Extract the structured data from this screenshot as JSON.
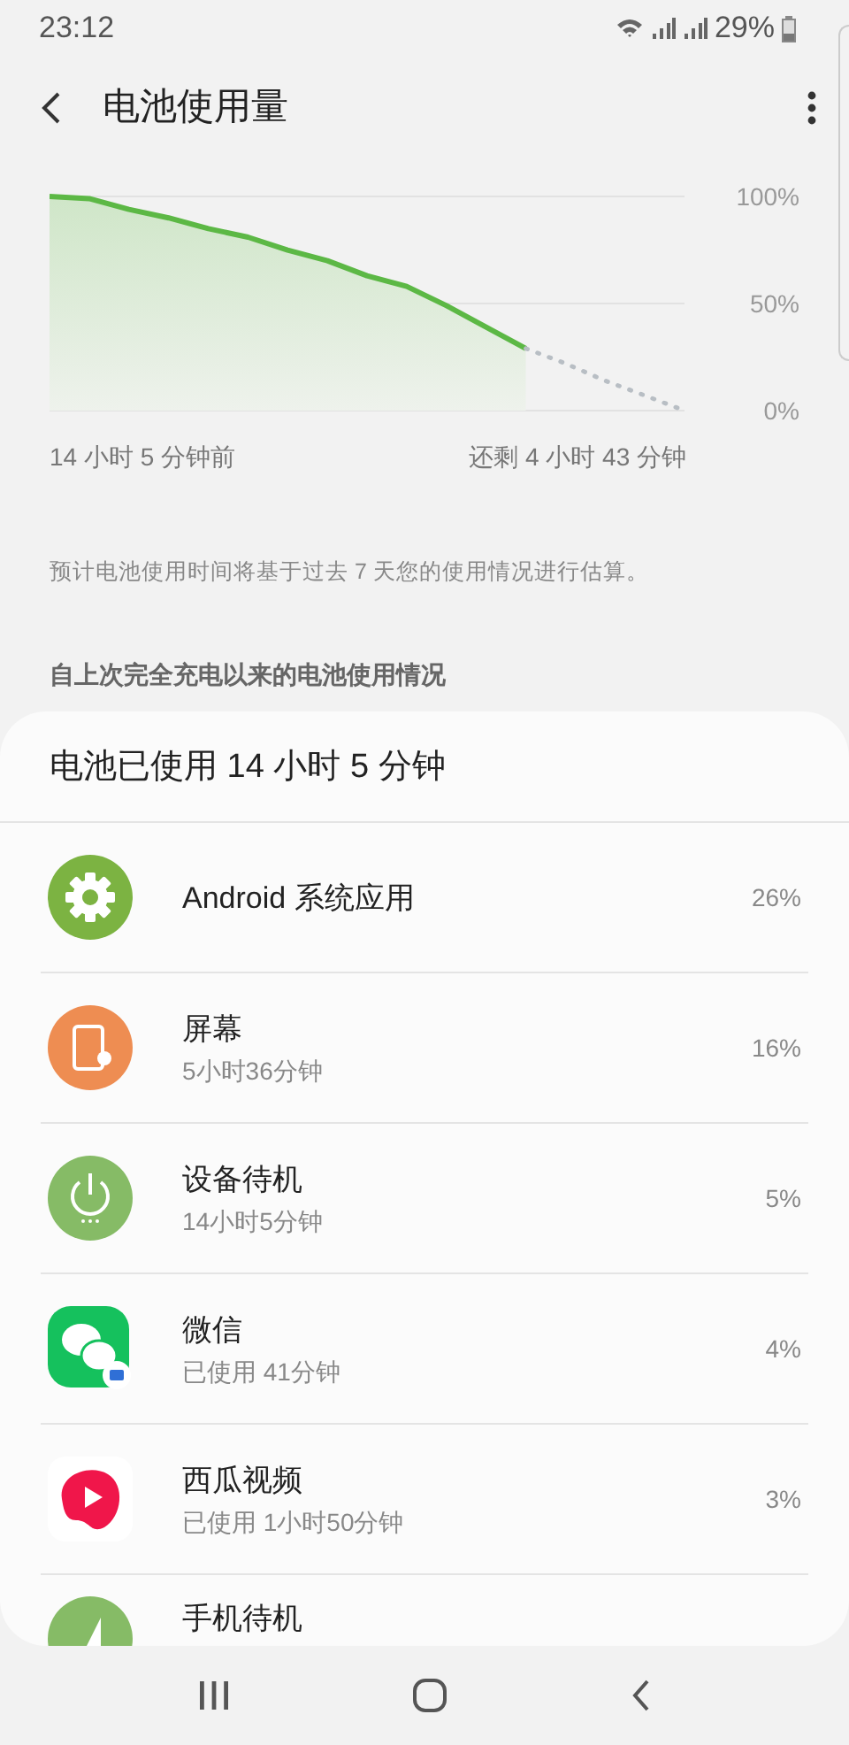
{
  "status_bar": {
    "time": "23:12",
    "battery_text": "29%"
  },
  "header": {
    "title": "电池使用量"
  },
  "usage_graph": {
    "range_start_label": "14 小时 5 分钟前",
    "range_end_label": "还剩 4 小时 43 分钟",
    "chart_data": {
      "type": "area",
      "categories": [
        null,
        null,
        null,
        null,
        null,
        null,
        null,
        null,
        null,
        null,
        null,
        null,
        null,
        null,
        null,
        null,
        null
      ],
      "ylim": [
        0,
        100
      ],
      "yticks": [
        {
          "value": 0,
          "label": "0%"
        },
        {
          "value": 50,
          "label": "50%"
        },
        {
          "value": 100,
          "label": "100%"
        }
      ],
      "series": [
        {
          "type": "area",
          "color": "#5cb845",
          "line_style": "solid",
          "values": [
            100,
            99,
            94,
            90,
            85,
            81,
            75,
            70,
            63,
            58,
            49,
            39,
            29,
            null,
            null,
            null,
            null
          ]
        },
        {
          "type": "line",
          "color": "#b8bec4",
          "line_style": "dotted",
          "values": [
            null,
            null,
            null,
            null,
            null,
            null,
            null,
            null,
            null,
            null,
            null,
            null,
            29,
            22,
            14,
            7,
            0
          ]
        }
      ]
    }
  },
  "note": "预计电池使用时间将基于过去 7 天您的使用情况进行估算。",
  "section_title": "自上次完全充电以来的电池使用情况",
  "usage_card": {
    "title": "电池已使用 14 小时 5 分钟",
    "items": [
      {
        "kind": "gear",
        "name": "Android 系统应用",
        "percent": "26%"
      },
      {
        "kind": "screen",
        "name": "屏幕",
        "detail": "5小时36分钟",
        "percent": "16%"
      },
      {
        "kind": "power",
        "name": "设备待机",
        "detail": "14小时5分钟",
        "percent": "5%"
      },
      {
        "kind": "chat",
        "name": "微信",
        "detail": "已使用 41分钟",
        "percent": "4%"
      },
      {
        "kind": "video",
        "name": "西瓜视频",
        "detail": "已使用 1小时50分钟",
        "percent": "3%"
      },
      {
        "kind": "phone",
        "name": "手机待机"
      }
    ]
  }
}
